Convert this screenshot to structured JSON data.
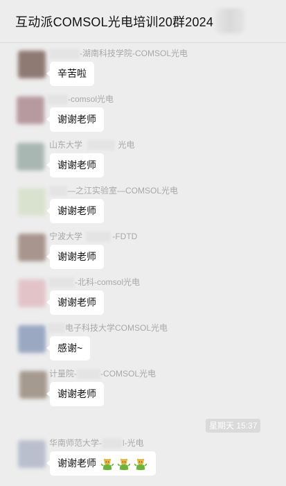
{
  "chat": {
    "title": "互动派COMSOL光电培训20群2024"
  },
  "messages": [
    {
      "sender_pre": "",
      "sender_post": "-湖南科技学院-COMSOL光电",
      "text": "辛苦啦",
      "avatar_color": "#8f7a73"
    },
    {
      "sender_pre": "",
      "sender_post": "-comsol光电",
      "text": "谢谢老师",
      "avatar_color": "#b79aa0"
    },
    {
      "sender_pre": "山东大学",
      "sender_post": "光电",
      "text": "谢谢老师",
      "avatar_color": "#a9b7b2"
    },
    {
      "sender_pre": "",
      "sender_post": "—之江实验室—COMSOL光电",
      "text": "谢谢老师",
      "avatar_color": "#d9e2cf"
    },
    {
      "sender_pre": "宁波大学",
      "sender_post": "-FDTD",
      "text": "谢谢老师",
      "avatar_color": "#a8958d"
    },
    {
      "sender_pre": "",
      "sender_post": "-北科-comsol光电",
      "text": "谢谢老师",
      "avatar_color": "#e2c4c8"
    },
    {
      "sender_pre": "",
      "sender_post": "电子科技大学COMSOL光电",
      "text": "感谢~",
      "avatar_color": "#9aa8c2"
    },
    {
      "sender_pre": "计量院-",
      "sender_post": "-COMSOL光电",
      "text": "谢谢老师",
      "avatar_color": "#a59a8f"
    },
    {
      "sender_pre": "华南师范大学-",
      "sender_post": "l-光电",
      "text": "谢谢老师",
      "avatar_color": "#b9bfcc",
      "emojis": [
        "dancing-bear-icon",
        "dancing-bear-icon",
        "dancing-bear-icon"
      ]
    }
  ],
  "timestamp": "星期天 15:37",
  "colors": {
    "background": "#ededed",
    "bubble": "#ffffff",
    "emoji": "#6bb33a"
  }
}
